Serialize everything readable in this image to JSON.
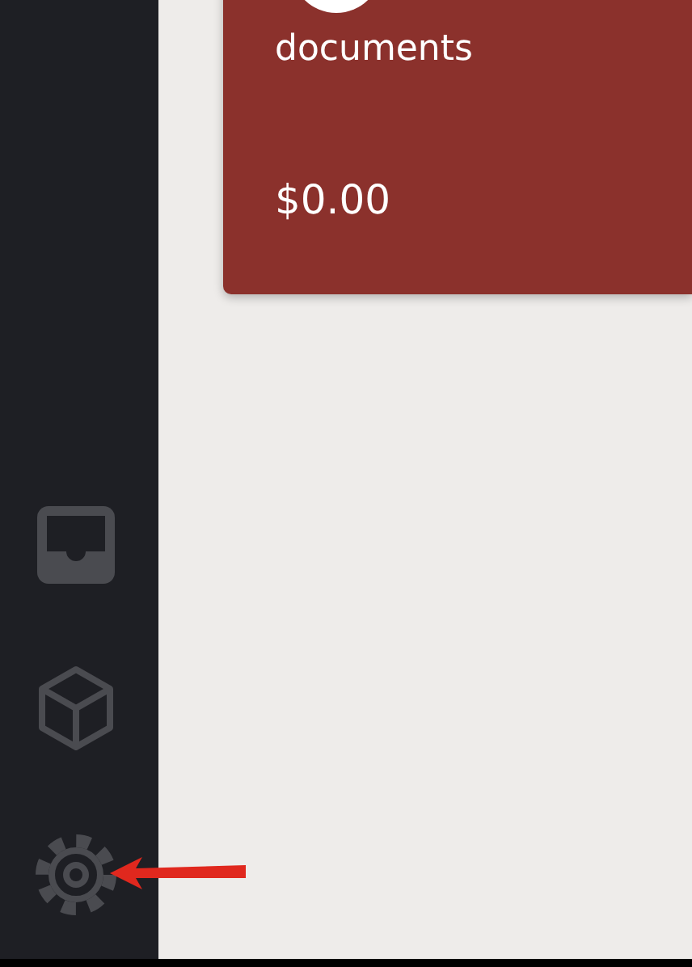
{
  "card": {
    "label": "documents",
    "amount": "$0.00"
  }
}
